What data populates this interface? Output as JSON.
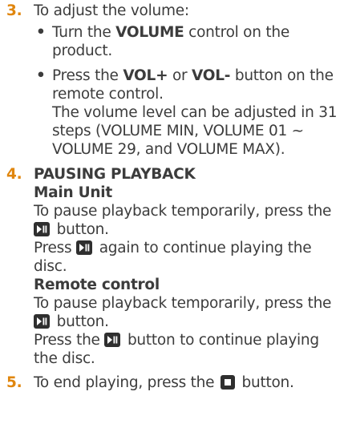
{
  "step3": {
    "number": "3.",
    "title": "To adjust the volume:",
    "bullet1": {
      "pre": "Turn the ",
      "bold": "VOLUME",
      "post": " control on the product."
    },
    "bullet2": {
      "pre": "Press the ",
      "bold1": "VOL+",
      "mid": " or ",
      "bold2": "VOL-",
      "post": " button on the remote control.",
      "note": "The volume level can be adjusted in 31 steps (VOLUME MIN, VOLUME 01 ~ VOLUME 29, and VOLUME MAX)."
    }
  },
  "step4": {
    "number": "4.",
    "title": "PAUSING PLAYBACK",
    "main_unit": {
      "label": "Main Unit",
      "line1": "To pause playback temporarily, press the",
      "line1_tail": " button.",
      "line2_pre": "Press ",
      "line2_post": " again to continue playing the disc."
    },
    "remote": {
      "label": "Remote control",
      "line1": "To pause playback temporarily, press the",
      "line1_tail": " button.",
      "line2_pre": "Press the ",
      "line2_post": " button to continue playing the disc."
    }
  },
  "step5": {
    "number": "5.",
    "pre": "To end playing, press the ",
    "post": " button."
  },
  "icons": {
    "play_pause": "play-pause-icon",
    "stop": "stop-icon"
  },
  "colors": {
    "step_number": "#e0860e",
    "text": "#3c3c3c",
    "icon_bg": "#2f2f2f"
  }
}
